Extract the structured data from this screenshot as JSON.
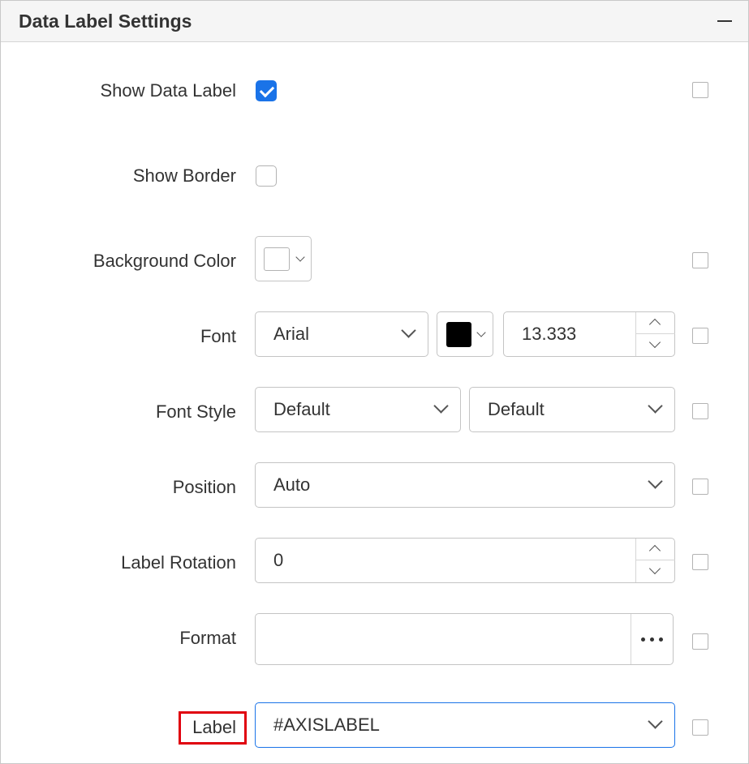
{
  "panel": {
    "title": "Data Label Settings",
    "collapse_icon": "minus-icon"
  },
  "rows": {
    "show_data_label": {
      "label": "Show Data Label",
      "checked": true
    },
    "show_border": {
      "label": "Show Border",
      "checked": false
    },
    "background_color": {
      "label": "Background Color",
      "color": "#ffffff"
    },
    "font": {
      "label": "Font",
      "family": "Arial",
      "color": "#000000",
      "size": "13.333"
    },
    "font_style": {
      "label": "Font Style",
      "style": "Default",
      "weight": "Default"
    },
    "position": {
      "label": "Position",
      "value": "Auto"
    },
    "label_rotation": {
      "label": "Label Rotation",
      "value": "0"
    },
    "format": {
      "label": "Format",
      "value": ""
    },
    "label": {
      "label": "Label",
      "value": "#AXISLABEL"
    }
  },
  "colors": {
    "accent": "#1a73e8",
    "highlight": "#e0000f",
    "border": "#c4c4c4"
  }
}
